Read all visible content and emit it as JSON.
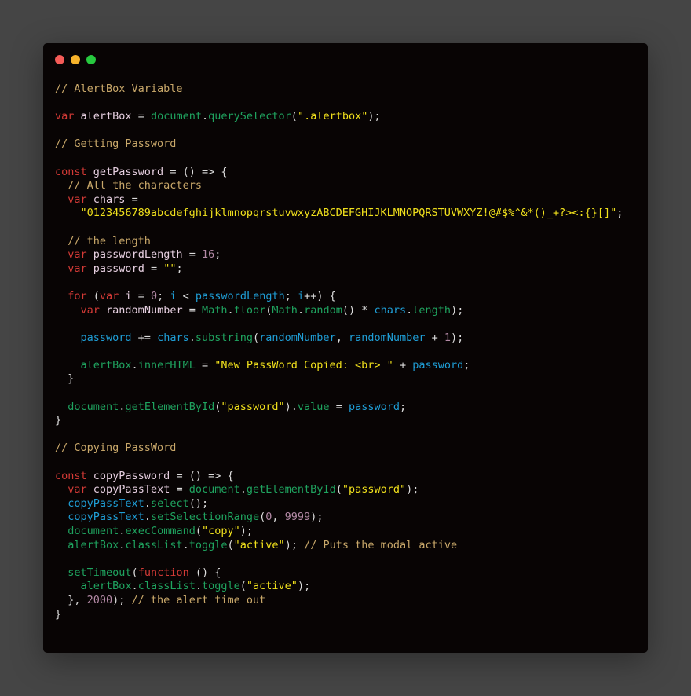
{
  "window": {
    "controls": [
      {
        "name": "close",
        "color": "#f45b57"
      },
      {
        "name": "minimize",
        "color": "#f7b32b"
      },
      {
        "name": "maximize",
        "color": "#27c93f"
      }
    ]
  },
  "token_colors": {
    "comment": "#c9a86a",
    "keyword": "#d33a36",
    "identifier": "#e6cfe0",
    "builtin_method": "#1fa35f",
    "variable_ref": "#1f9ed6",
    "string": "#f0e01c",
    "number": "#b48aa6",
    "punctuation": "#dcdcdc"
  },
  "code": {
    "language": "javascript",
    "lines": [
      [
        [
          "comment",
          "// AlertBox Variable"
        ]
      ],
      [],
      [
        [
          "keyword",
          "var"
        ],
        [
          "punct",
          " "
        ],
        [
          "ident",
          "alertBox"
        ],
        [
          "punct",
          " = "
        ],
        [
          "green",
          "document"
        ],
        [
          "punct",
          "."
        ],
        [
          "green",
          "querySelector"
        ],
        [
          "punct",
          "("
        ],
        [
          "string",
          "\".alertbox\""
        ],
        [
          "punct",
          ");"
        ]
      ],
      [],
      [
        [
          "comment",
          "// Getting Password"
        ]
      ],
      [],
      [
        [
          "keyword",
          "const"
        ],
        [
          "punct",
          " "
        ],
        [
          "ident",
          "getPassword"
        ],
        [
          "punct",
          " = () => {"
        ]
      ],
      [
        [
          "punct",
          "  "
        ],
        [
          "comment",
          "// All the characters"
        ]
      ],
      [
        [
          "punct",
          "  "
        ],
        [
          "keyword",
          "var"
        ],
        [
          "punct",
          " "
        ],
        [
          "ident",
          "chars"
        ],
        [
          "punct",
          " ="
        ]
      ],
      [
        [
          "punct",
          "    "
        ],
        [
          "string",
          "\"0123456789abcdefghijklmnopqrstuvwxyzABCDEFGHIJKLMNOPQRSTUVWXYZ!@#$%^&*()_+?><:{}[]\""
        ],
        [
          "punct",
          ";"
        ]
      ],
      [],
      [
        [
          "punct",
          "  "
        ],
        [
          "comment",
          "// the length"
        ]
      ],
      [
        [
          "punct",
          "  "
        ],
        [
          "keyword",
          "var"
        ],
        [
          "punct",
          " "
        ],
        [
          "ident",
          "passwordLength"
        ],
        [
          "punct",
          " = "
        ],
        [
          "number",
          "16"
        ],
        [
          "punct",
          ";"
        ]
      ],
      [
        [
          "punct",
          "  "
        ],
        [
          "keyword",
          "var"
        ],
        [
          "punct",
          " "
        ],
        [
          "ident",
          "password"
        ],
        [
          "punct",
          " = "
        ],
        [
          "string",
          "\"\""
        ],
        [
          "punct",
          ";"
        ]
      ],
      [],
      [
        [
          "punct",
          "  "
        ],
        [
          "keyword",
          "for"
        ],
        [
          "punct",
          " ("
        ],
        [
          "keyword",
          "var"
        ],
        [
          "punct",
          " "
        ],
        [
          "ident",
          "i"
        ],
        [
          "punct",
          " = "
        ],
        [
          "number",
          "0"
        ],
        [
          "punct",
          "; "
        ],
        [
          "blue",
          "i"
        ],
        [
          "punct",
          " < "
        ],
        [
          "blue",
          "passwordLength"
        ],
        [
          "punct",
          "; "
        ],
        [
          "blue",
          "i"
        ],
        [
          "punct",
          "++) {"
        ]
      ],
      [
        [
          "punct",
          "    "
        ],
        [
          "keyword",
          "var"
        ],
        [
          "punct",
          " "
        ],
        [
          "ident",
          "randomNumber"
        ],
        [
          "punct",
          " = "
        ],
        [
          "green",
          "Math"
        ],
        [
          "punct",
          "."
        ],
        [
          "green",
          "floor"
        ],
        [
          "punct",
          "("
        ],
        [
          "green",
          "Math"
        ],
        [
          "punct",
          "."
        ],
        [
          "green",
          "random"
        ],
        [
          "punct",
          "() * "
        ],
        [
          "blue",
          "chars"
        ],
        [
          "punct",
          "."
        ],
        [
          "green",
          "length"
        ],
        [
          "punct",
          ");"
        ]
      ],
      [],
      [
        [
          "punct",
          "    "
        ],
        [
          "blue",
          "password"
        ],
        [
          "punct",
          " += "
        ],
        [
          "blue",
          "chars"
        ],
        [
          "punct",
          "."
        ],
        [
          "green",
          "substring"
        ],
        [
          "punct",
          "("
        ],
        [
          "blue",
          "randomNumber"
        ],
        [
          "punct",
          ", "
        ],
        [
          "blue",
          "randomNumber"
        ],
        [
          "punct",
          " + "
        ],
        [
          "number",
          "1"
        ],
        [
          "punct",
          ");"
        ]
      ],
      [],
      [
        [
          "punct",
          "    "
        ],
        [
          "green",
          "alertBox"
        ],
        [
          "punct",
          "."
        ],
        [
          "green",
          "innerHTML"
        ],
        [
          "punct",
          " = "
        ],
        [
          "string",
          "\"New PassWord Copied: <br> \""
        ],
        [
          "punct",
          " + "
        ],
        [
          "blue",
          "password"
        ],
        [
          "punct",
          ";"
        ]
      ],
      [
        [
          "punct",
          "  }"
        ]
      ],
      [],
      [
        [
          "punct",
          "  "
        ],
        [
          "green",
          "document"
        ],
        [
          "punct",
          "."
        ],
        [
          "green",
          "getElementById"
        ],
        [
          "punct",
          "("
        ],
        [
          "string",
          "\"password\""
        ],
        [
          "punct",
          ")."
        ],
        [
          "green",
          "value"
        ],
        [
          "punct",
          " = "
        ],
        [
          "blue",
          "password"
        ],
        [
          "punct",
          ";"
        ]
      ],
      [
        [
          "punct",
          "}"
        ]
      ],
      [],
      [
        [
          "comment",
          "// Copying PassWord"
        ]
      ],
      [],
      [
        [
          "keyword",
          "const"
        ],
        [
          "punct",
          " "
        ],
        [
          "ident",
          "copyPassword"
        ],
        [
          "punct",
          " = () => {"
        ]
      ],
      [
        [
          "punct",
          "  "
        ],
        [
          "keyword",
          "var"
        ],
        [
          "punct",
          " "
        ],
        [
          "ident",
          "copyPassText"
        ],
        [
          "punct",
          " = "
        ],
        [
          "green",
          "document"
        ],
        [
          "punct",
          "."
        ],
        [
          "green",
          "getElementById"
        ],
        [
          "punct",
          "("
        ],
        [
          "string",
          "\"password\""
        ],
        [
          "punct",
          ");"
        ]
      ],
      [
        [
          "punct",
          "  "
        ],
        [
          "blue",
          "copyPassText"
        ],
        [
          "punct",
          "."
        ],
        [
          "green",
          "select"
        ],
        [
          "punct",
          "();"
        ]
      ],
      [
        [
          "punct",
          "  "
        ],
        [
          "blue",
          "copyPassText"
        ],
        [
          "punct",
          "."
        ],
        [
          "green",
          "setSelectionRange"
        ],
        [
          "punct",
          "("
        ],
        [
          "number",
          "0"
        ],
        [
          "punct",
          ", "
        ],
        [
          "number",
          "9999"
        ],
        [
          "punct",
          ");"
        ]
      ],
      [
        [
          "punct",
          "  "
        ],
        [
          "green",
          "document"
        ],
        [
          "punct",
          "."
        ],
        [
          "green",
          "execCommand"
        ],
        [
          "punct",
          "("
        ],
        [
          "string",
          "\"copy\""
        ],
        [
          "punct",
          ");"
        ]
      ],
      [
        [
          "punct",
          "  "
        ],
        [
          "green",
          "alertBox"
        ],
        [
          "punct",
          "."
        ],
        [
          "green",
          "classList"
        ],
        [
          "punct",
          "."
        ],
        [
          "green",
          "toggle"
        ],
        [
          "punct",
          "("
        ],
        [
          "string",
          "\"active\""
        ],
        [
          "punct",
          "); "
        ],
        [
          "comment",
          "// Puts the modal active"
        ]
      ],
      [],
      [
        [
          "punct",
          "  "
        ],
        [
          "green",
          "setTimeout"
        ],
        [
          "punct",
          "("
        ],
        [
          "keyword",
          "function"
        ],
        [
          "punct",
          " () {"
        ]
      ],
      [
        [
          "punct",
          "    "
        ],
        [
          "green",
          "alertBox"
        ],
        [
          "punct",
          "."
        ],
        [
          "green",
          "classList"
        ],
        [
          "punct",
          "."
        ],
        [
          "green",
          "toggle"
        ],
        [
          "punct",
          "("
        ],
        [
          "string",
          "\"active\""
        ],
        [
          "punct",
          ");"
        ]
      ],
      [
        [
          "punct",
          "  }, "
        ],
        [
          "number",
          "2000"
        ],
        [
          "punct",
          "); "
        ],
        [
          "comment",
          "// the alert time out"
        ]
      ],
      [
        [
          "punct",
          "}"
        ]
      ]
    ]
  }
}
